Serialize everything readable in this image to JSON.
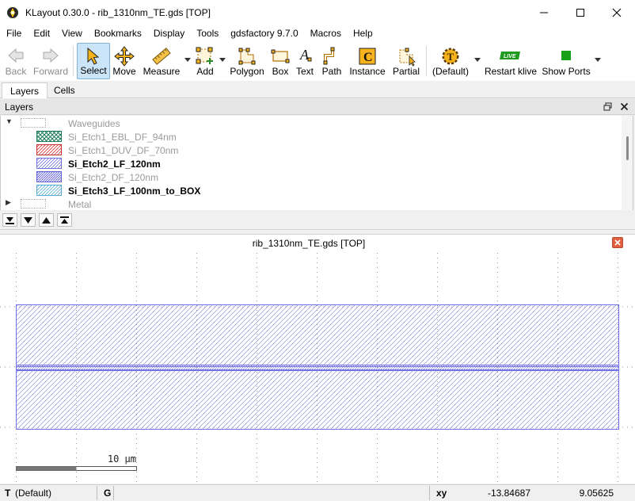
{
  "window": {
    "title": "KLayout 0.30.0 - rib_1310nm_TE.gds [TOP]",
    "app_icon": "klayout-logo-icon",
    "controls": [
      "minimize-icon",
      "maximize-icon",
      "close-icon"
    ]
  },
  "menu": [
    "File",
    "Edit",
    "View",
    "Bookmarks",
    "Display",
    "Tools",
    "gdsfactory 9.7.0",
    "Macros",
    "Help"
  ],
  "toolbar": {
    "back": "Back",
    "forward": "Forward",
    "select": "Select",
    "move": "Move",
    "measure": "Measure",
    "add": "Add",
    "polygon": "Polygon",
    "box": "Box",
    "text": "Text",
    "path": "Path",
    "instance": "Instance",
    "partial": "Partial",
    "default": "(Default)",
    "restart_klive": "Restart klive",
    "klive_badge": "LIVE",
    "show_ports": "Show Ports",
    "text_glyph": "A",
    "instance_glyph": "C",
    "default_glyph": "T"
  },
  "tabs": [
    "Layers",
    "Cells"
  ],
  "layers_panel": {
    "title": "Layers",
    "groups": [
      {
        "name": "Waveguides",
        "expanded": true
      },
      {
        "name": "Metal",
        "expanded": false
      }
    ],
    "layers": [
      {
        "name": "Si_Etch1_EBL_DF_94nm",
        "visible": false,
        "color": "#1a7a56",
        "pattern": "crosshatch"
      },
      {
        "name": "Si_Etch1_DUV_DF_70nm",
        "visible": false,
        "color": "#d03030",
        "pattern": "diagonal"
      },
      {
        "name": "Si_Etch2_LF_120nm",
        "visible": true,
        "color": "#7070e0",
        "pattern": "diagonal"
      },
      {
        "name": "Si_Etch2_DF_120nm",
        "visible": false,
        "color": "#6060d8",
        "pattern": "dense-diagonal"
      },
      {
        "name": "Si_Etch3_LF_100nm_to_BOX",
        "visible": true,
        "color": "#5aa8d8",
        "pattern": "diagonal"
      }
    ]
  },
  "canvas": {
    "title": "rib_1310nm_TE.gds [TOP]",
    "scale_label": "10 µm",
    "shape_color": "#6f6fe8"
  },
  "status": {
    "mode_key": "T",
    "mode": "(Default)",
    "grid_key": "G",
    "coord_label": "xy",
    "x": "-13.84687",
    "y": "9.05625"
  }
}
